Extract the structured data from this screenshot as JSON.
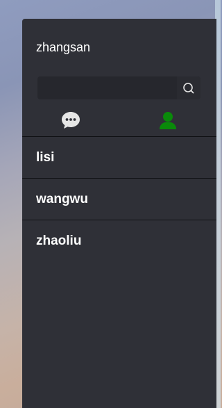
{
  "user": {
    "name": "zhangsan"
  },
  "search": {
    "value": "",
    "placeholder": "",
    "icon": "search-icon"
  },
  "tabs": [
    {
      "name": "chat",
      "icon": "chat-bubble-icon",
      "color": "#e6e6e6",
      "active": false
    },
    {
      "name": "contacts",
      "icon": "person-icon",
      "color": "#0a8a0a",
      "active": true
    }
  ],
  "contacts": [
    {
      "name": "lisi"
    },
    {
      "name": "wangwu"
    },
    {
      "name": "zhaoliu"
    }
  ],
  "colors": {
    "panel": "#2f3037",
    "search_bg": "#26272d",
    "active_tab": "#0a8a0a",
    "divider": "#101114"
  }
}
